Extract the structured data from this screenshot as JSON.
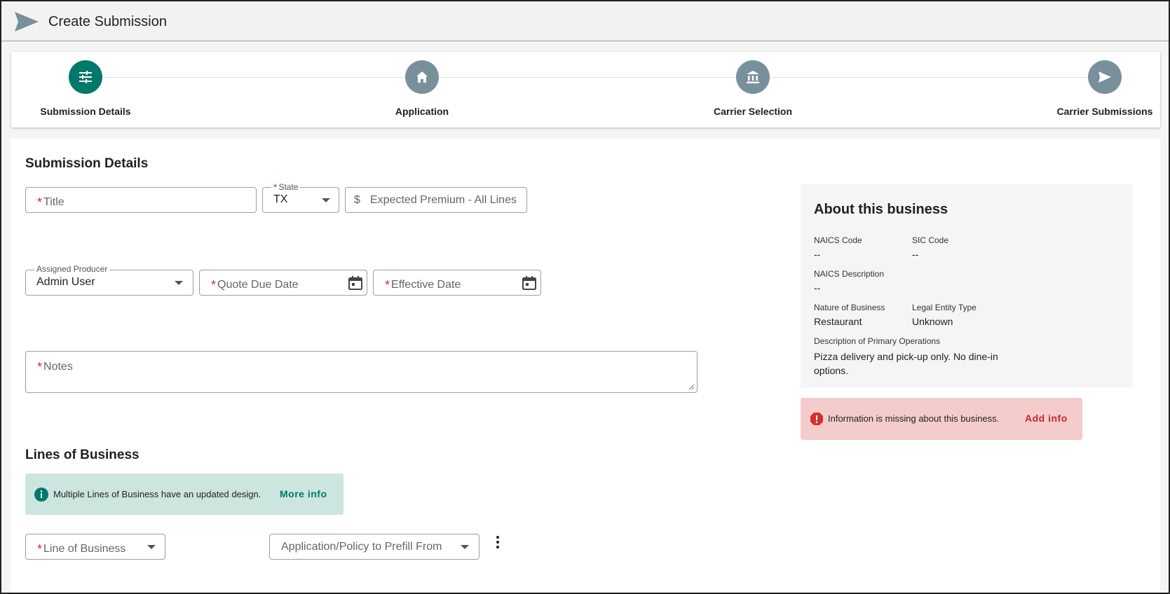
{
  "header": {
    "title": "Create Submission",
    "logo_icon": "send-icon"
  },
  "stepper": {
    "steps": [
      {
        "label": "Submission Details",
        "icon": "tune-icon",
        "active": true
      },
      {
        "label": "Application",
        "icon": "home-icon",
        "active": false
      },
      {
        "label": "Carrier Selection",
        "icon": "bank-icon",
        "active": false
      },
      {
        "label": "Carrier Submissions",
        "icon": "send-icon",
        "active": false
      }
    ],
    "colors": {
      "active": "#00796b",
      "inactive": "#78909c"
    }
  },
  "submission_details": {
    "heading": "Submission Details",
    "title_field": {
      "placeholder": "Title",
      "required": true,
      "value": ""
    },
    "state_field": {
      "label": "State",
      "required": true,
      "value": "TX"
    },
    "premium_field": {
      "prefix": "$",
      "placeholder": "Expected Premium - All Lines",
      "value": ""
    },
    "producer_field": {
      "label": "Assigned Producer",
      "value": "Admin User"
    },
    "quote_due_field": {
      "placeholder": "Quote Due Date",
      "required": true,
      "value": ""
    },
    "effective_date_field": {
      "placeholder": "Effective Date",
      "required": true,
      "value": ""
    },
    "notes_field": {
      "placeholder": "Notes",
      "required": true,
      "value": ""
    }
  },
  "lines_of_business": {
    "heading": "Lines of Business",
    "info_alert": {
      "message": "Multiple Lines of Business have an updated design.",
      "action": "More info"
    },
    "line_select": {
      "placeholder": "Line of Business",
      "required": true
    },
    "prefill_select": {
      "placeholder": "Application/Policy to Prefill From"
    }
  },
  "about_business": {
    "title": "About this business",
    "naics_code": {
      "label": "NAICS Code",
      "value": "--"
    },
    "sic_code": {
      "label": "SIC Code",
      "value": "--"
    },
    "naics_description": {
      "label": "NAICS Description",
      "value": "--"
    },
    "nature_of_business": {
      "label": "Nature of Business",
      "value": "Restaurant"
    },
    "legal_entity_type": {
      "label": "Legal Entity Type",
      "value": "Unknown"
    },
    "primary_operations": {
      "label": "Description of Primary Operations",
      "value": "Pizza delivery and pick-up only. No dine-in options."
    }
  },
  "missing_info_alert": {
    "message": "Information is missing about this business.",
    "action": "Add info"
  },
  "required_marker": "*"
}
